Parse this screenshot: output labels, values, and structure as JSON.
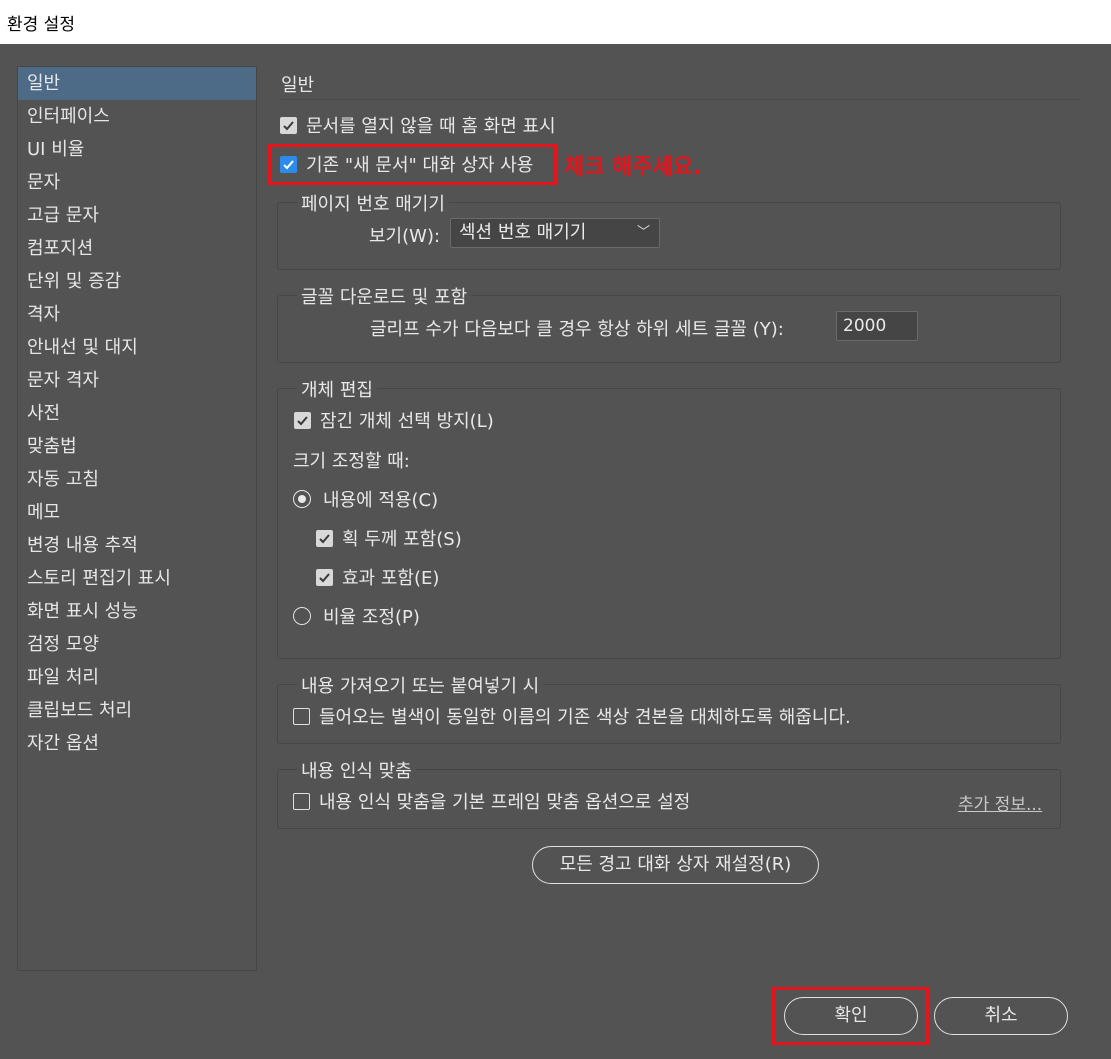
{
  "window": {
    "title": "환경 설정"
  },
  "sidebar": {
    "items": [
      {
        "label": "일반"
      },
      {
        "label": "인터페이스"
      },
      {
        "label": "UI 비율"
      },
      {
        "label": "문자"
      },
      {
        "label": "고급 문자"
      },
      {
        "label": "컴포지션"
      },
      {
        "label": "단위 및 증감"
      },
      {
        "label": "격자"
      },
      {
        "label": "안내선 및 대지"
      },
      {
        "label": "문자 격자"
      },
      {
        "label": "사전"
      },
      {
        "label": "맞춤법"
      },
      {
        "label": "자동 고침"
      },
      {
        "label": "메모"
      },
      {
        "label": "변경 내용 추적"
      },
      {
        "label": "스토리 편집기 표시"
      },
      {
        "label": "화면 표시 성능"
      },
      {
        "label": "검정 모양"
      },
      {
        "label": "파일 처리"
      },
      {
        "label": "클립보드 처리"
      },
      {
        "label": "자간 옵션"
      }
    ],
    "selected": "일반"
  },
  "main": {
    "section_title": "일반",
    "show_home": {
      "label": "문서를 열지 않을 때 홈 화면 표시",
      "checked": true
    },
    "legacy_new_doc": {
      "label": "기존 \"새 문서\" 대화 상자 사용",
      "checked": true
    },
    "annotation": "체크 해주세요.",
    "page_numbering": {
      "group_label": "페이지 번호 매기기",
      "view_label": "보기(W):",
      "view_value": "섹션 번호 매기기"
    },
    "font_download": {
      "group_label": "글꼴 다운로드 및 포함",
      "glyph_label": "글리프 수가 다음보다 클 경우 항상 하위 세트 글꼴 (Y):",
      "glyph_value": "2000"
    },
    "object_editing": {
      "group_label": "개체 편집",
      "prevent_locked": {
        "label": "잠긴 개체 선택 방지(L)",
        "checked": true
      },
      "scaling_label": "크기 조정할 때:",
      "apply_to_content": {
        "label": "내용에 적용(C)",
        "selected": true
      },
      "include_stroke": {
        "label": "획 두께 포함(S)",
        "checked": true
      },
      "include_effects": {
        "label": "효과 포함(E)",
        "checked": true
      },
      "adjust_scale": {
        "label": "비율 조정(P)",
        "selected": false
      }
    },
    "paste": {
      "group_label": "내용 가져오기 또는 붙여넣기 시",
      "replace_swatches": {
        "label": "들어오는 별색이 동일한 이름의 기존 색상 견본을 대체하도록 해줍니다.",
        "checked": false
      }
    },
    "content_aware": {
      "group_label": "내용 인식 맞춤",
      "default_fit": {
        "label": "내용 인식 맞춤을 기본 프레임 맞춤 옵션으로 설정",
        "checked": false
      },
      "more_info": "추가 정보..."
    },
    "reset_warnings": "모든 경고 대화 상자 재설정(R)"
  },
  "footer": {
    "ok": "확인",
    "cancel": "취소"
  },
  "colors": {
    "annotation_red": "#e8141c",
    "selected_item": "#4d6a87",
    "checkbox_blue": "#2d8ceb",
    "background": "#535353"
  }
}
